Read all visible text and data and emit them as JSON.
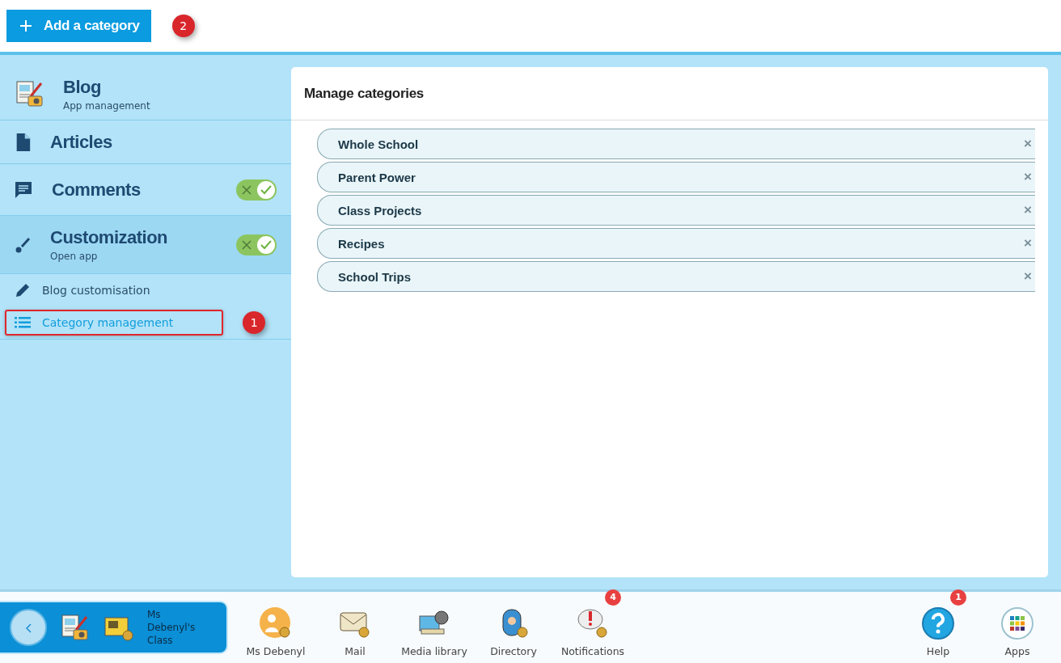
{
  "toolbar": {
    "add_button": "Add a category",
    "annotation": "2"
  },
  "sidebar": {
    "app": {
      "title": "Blog",
      "subtitle": "App management"
    },
    "items": [
      {
        "kind": "page",
        "label": "Articles",
        "selected": false
      },
      {
        "kind": "toggle",
        "label": "Comments",
        "on": true,
        "selected": false
      },
      {
        "kind": "toggle",
        "label": "Customization",
        "subtitle": "Open app",
        "on": true,
        "selected": true
      }
    ],
    "subitems": [
      {
        "label": "Blog customisation",
        "selected": false
      },
      {
        "label": "Category management",
        "selected": true,
        "annotation": "1"
      }
    ]
  },
  "panel": {
    "title": "Manage categories",
    "categories": [
      {
        "label": "Whole School",
        "remove": "×"
      },
      {
        "label": "Parent Power",
        "remove": "×"
      },
      {
        "label": "Class Projects",
        "remove": "×"
      },
      {
        "label": "Recipes",
        "remove": "×"
      },
      {
        "label": "School Trips",
        "remove": "×"
      }
    ]
  },
  "dock": {
    "context": "Ms Debenyl's Class",
    "apps": [
      {
        "label": "Ms Debenyl"
      },
      {
        "label": "Mail"
      },
      {
        "label": "Media library"
      },
      {
        "label": "Directory"
      },
      {
        "label": "Notifications",
        "badge": "4"
      }
    ],
    "right": [
      {
        "label": "Help",
        "badge": "1"
      },
      {
        "label": "Apps"
      }
    ]
  }
}
